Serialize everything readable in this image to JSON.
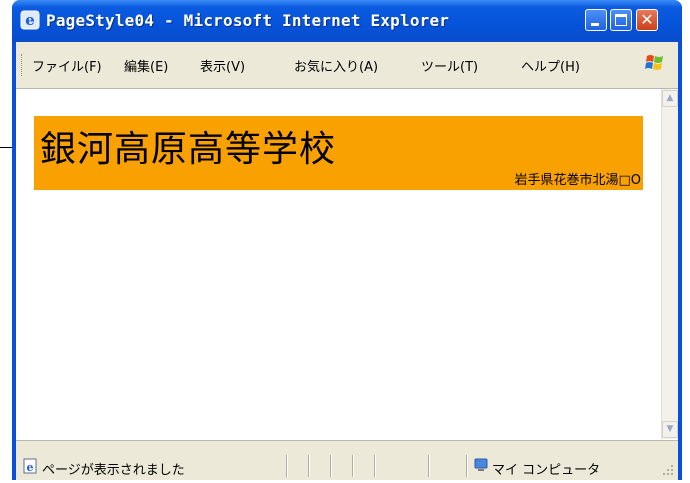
{
  "window": {
    "title": "PageStyle04 - Microsoft Internet Explorer",
    "titlebar_color": "#0553d8",
    "close_button_color": "#c8411a"
  },
  "menu": {
    "items": [
      {
        "label": "ファイル(F)"
      },
      {
        "label": "編集(E)"
      },
      {
        "label": "表示(V)"
      },
      {
        "label": "お気に入り(A)"
      },
      {
        "label": "ツール(T)"
      },
      {
        "label": "ヘルプ(H)"
      }
    ]
  },
  "page": {
    "banner_color": "#f9a100",
    "school_name": "銀河高原高等学校",
    "address": "岩手県花巻市北湯□O"
  },
  "status": {
    "text": "ページが表示されました",
    "zone": "マイ コンピュータ"
  }
}
